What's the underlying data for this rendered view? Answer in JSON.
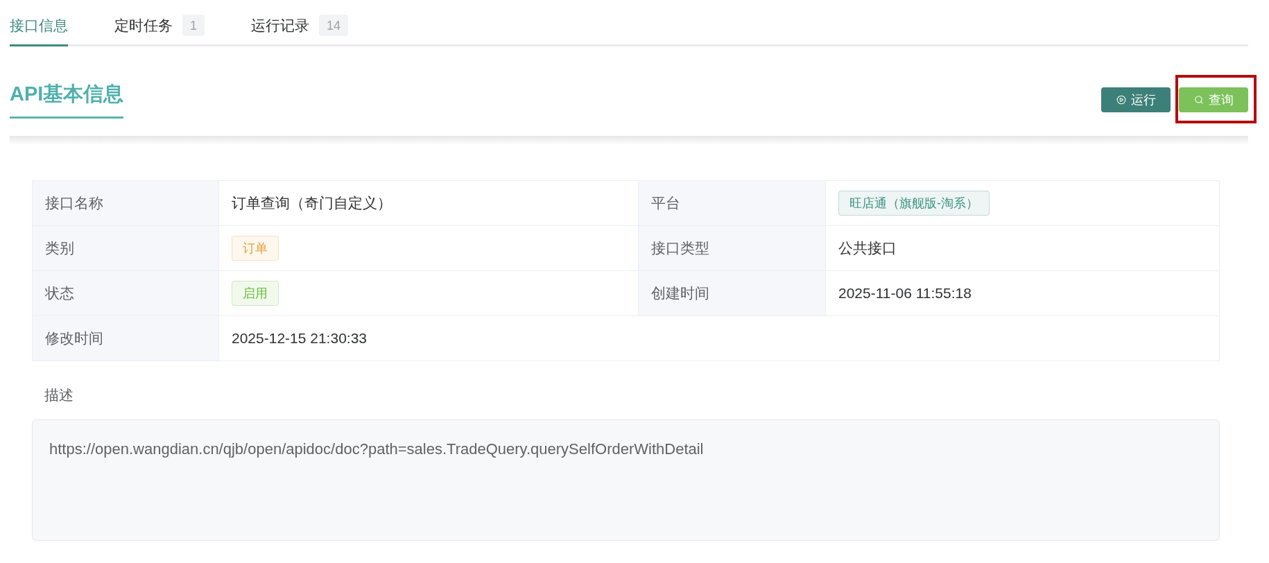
{
  "tabs": [
    {
      "label": "接口信息",
      "selected": true
    },
    {
      "label": "定时任务",
      "count": "1",
      "selected": false
    },
    {
      "label": "运行记录",
      "count": "14",
      "selected": false
    }
  ],
  "section": {
    "title": "API基本信息",
    "actions": [
      {
        "label": "运行",
        "kind": "run",
        "highlighted": false
      },
      {
        "label": "查询",
        "kind": "query",
        "highlighted": true
      }
    ]
  },
  "info_table": {
    "rows": [
      [
        {
          "label": "接口名称",
          "value": "订单查询（奇门自定义）",
          "kind": "text"
        },
        {
          "label": "平台",
          "value": "旺店通（旗舰版-淘系）",
          "kind": "tag",
          "color": "#3f9284"
        }
      ],
      [
        {
          "label": "类别",
          "value": "订单",
          "kind": "tag",
          "color": "#e6a23c"
        },
        {
          "label": "接口类型",
          "value": "公共接口",
          "kind": "text"
        }
      ],
      [
        {
          "label": "状态",
          "value": "启用",
          "kind": "tag",
          "color": "#67c23a"
        },
        {
          "label": "创建时间",
          "value": "2025-11-06 11:55:18",
          "kind": "text"
        }
      ],
      [
        {
          "label": "修改时间",
          "value": "2025-12-15 21:30:33",
          "kind": "text"
        }
      ]
    ]
  },
  "description": {
    "label": "描述",
    "value": "https://open.wangdian.cn/qjb/open/apidoc/doc?path=sales.TradeQuery.querySelfOrderWithDetail"
  }
}
